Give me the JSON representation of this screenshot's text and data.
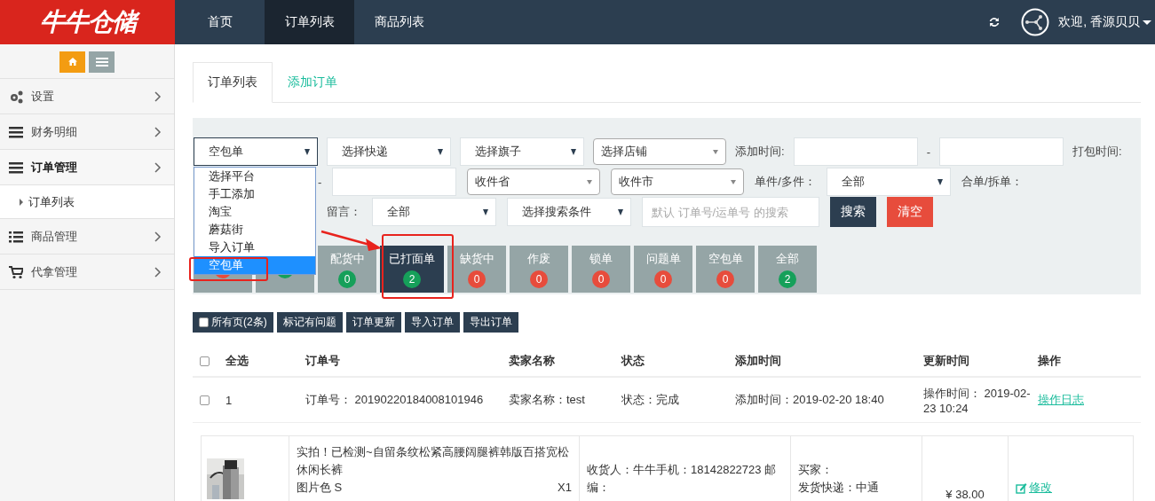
{
  "logo": {
    "text": "牛牛仓储"
  },
  "nav": [
    {
      "label": "首页",
      "selected": false
    },
    {
      "label": "订单列表",
      "selected": true
    },
    {
      "label": "商品列表",
      "selected": false
    }
  ],
  "user": {
    "greeting": "欢迎, 香源贝贝"
  },
  "sidebar": {
    "items": [
      {
        "label": "设置",
        "kind": "gears",
        "expanded": false
      },
      {
        "label": "财务明细",
        "kind": "bars",
        "expanded": false
      },
      {
        "label": "订单管理",
        "kind": "bars",
        "expanded": true,
        "children": [
          {
            "label": "订单列表",
            "selected": true
          }
        ]
      },
      {
        "label": "商品管理",
        "kind": "list",
        "expanded": false
      },
      {
        "label": "代拿管理",
        "kind": "cart",
        "expanded": false
      }
    ]
  },
  "tabs": [
    {
      "label": "订单列表",
      "selected": true
    },
    {
      "label": "添加订单",
      "selected": false
    }
  ],
  "filters": {
    "line_1": [
      {
        "kind": "select",
        "value": "空包单",
        "focused": true
      },
      {
        "kind": "select",
        "value": "选择快递"
      },
      {
        "kind": "select",
        "value": "选择旗子"
      },
      {
        "kind": "select-rounded",
        "value": "选择店铺"
      },
      {
        "kind": "label",
        "text": "添加时间:"
      },
      {
        "kind": "input"
      },
      {
        "kind": "dash",
        "text": "-"
      },
      {
        "kind": "input"
      },
      {
        "kind": "label",
        "text": "打包时间:"
      }
    ],
    "line_2": [
      {
        "kind": "dash",
        "text": "-"
      },
      {
        "kind": "input"
      },
      {
        "kind": "select-rounded",
        "value": "收件省"
      },
      {
        "kind": "select-rounded",
        "value": "收件市"
      },
      {
        "kind": "label",
        "text": "单件/多件："
      },
      {
        "kind": "select",
        "value": "全部"
      },
      {
        "kind": "label",
        "text": "合单/拆单："
      }
    ],
    "line_3": [
      {
        "kind": "label",
        "text": "留言："
      },
      {
        "kind": "select",
        "value": "全部"
      },
      {
        "kind": "select",
        "value": "选择搜索条件"
      },
      {
        "kind": "search",
        "placeholder": "默认 订单号/运单号 的搜索"
      },
      {
        "kind": "button-dark",
        "text": "搜索"
      },
      {
        "kind": "button-red",
        "text": "清空"
      }
    ]
  },
  "dropdown": {
    "options": [
      {
        "label": "选择平台",
        "selected": false
      },
      {
        "label": "手工添加",
        "selected": false
      },
      {
        "label": "淘宝",
        "selected": false
      },
      {
        "label": "蘑菇街",
        "selected": false
      },
      {
        "label": "导入订单",
        "selected": false
      },
      {
        "label": "空包单",
        "selected": true
      }
    ]
  },
  "status_tiles": [
    {
      "color": "#e74c3c",
      "selected": false
    },
    {
      "color": "#16a05a",
      "selected": false
    },
    {
      "label": "配货中",
      "count": "0",
      "color": "#16a05a",
      "selected": false
    },
    {
      "label": "已打面单",
      "count": "2",
      "color": "#16a05a",
      "selected": true
    },
    {
      "label": "缺货中",
      "count": "0",
      "color": "#e74c3c",
      "selected": false
    },
    {
      "label": "作废",
      "count": "0",
      "color": "#e74c3c",
      "selected": false
    },
    {
      "label": "锁单",
      "count": "0",
      "color": "#e74c3c",
      "selected": false
    },
    {
      "label": "问题单",
      "count": "0",
      "color": "#e74c3c",
      "selected": false
    },
    {
      "label": "空包单",
      "count": "0",
      "color": "#e74c3c",
      "selected": false
    },
    {
      "label": "全部",
      "count": "2",
      "color": "#16a05a",
      "selected": false
    }
  ],
  "actions": [
    {
      "label": "所有页(2条)",
      "kind": "checkbox",
      "checked": false
    },
    {
      "label": "标记有问题",
      "kind": "plain"
    },
    {
      "label": "订单更新",
      "kind": "plain"
    },
    {
      "label": "导入订单",
      "kind": "plain"
    },
    {
      "label": "导出订单",
      "kind": "plain"
    }
  ],
  "table": {
    "select_all": {
      "checked": false
    },
    "columns": [
      "全选",
      "订单号",
      "卖家名称",
      "状态",
      "添加时间",
      "更新时间",
      "操作"
    ],
    "rows": [
      {
        "checked": false,
        "cells": [
          "1",
          "订单号： 20190220184008101946",
          "卖家名称：test",
          "状态：完成",
          "添加时间：2019-02-20 18:40",
          "操作时间： 2019-02-23 10:24"
        ],
        "link": "操作日志"
      }
    ]
  },
  "detail": {
    "kind": "picture",
    "title": "实拍！已检测~自留条纹松紧高腰阔腿裤韩版百搭宽松休闲长裤",
    "variant": "图片色 S",
    "quantity": "X1",
    "receiver": "收货人：牛牛手机：18142822723 邮编：",
    "buyer": "买家：",
    "courier": "发货快递：中通",
    "price": "¥ 38.00",
    "edit_link": "修改"
  }
}
